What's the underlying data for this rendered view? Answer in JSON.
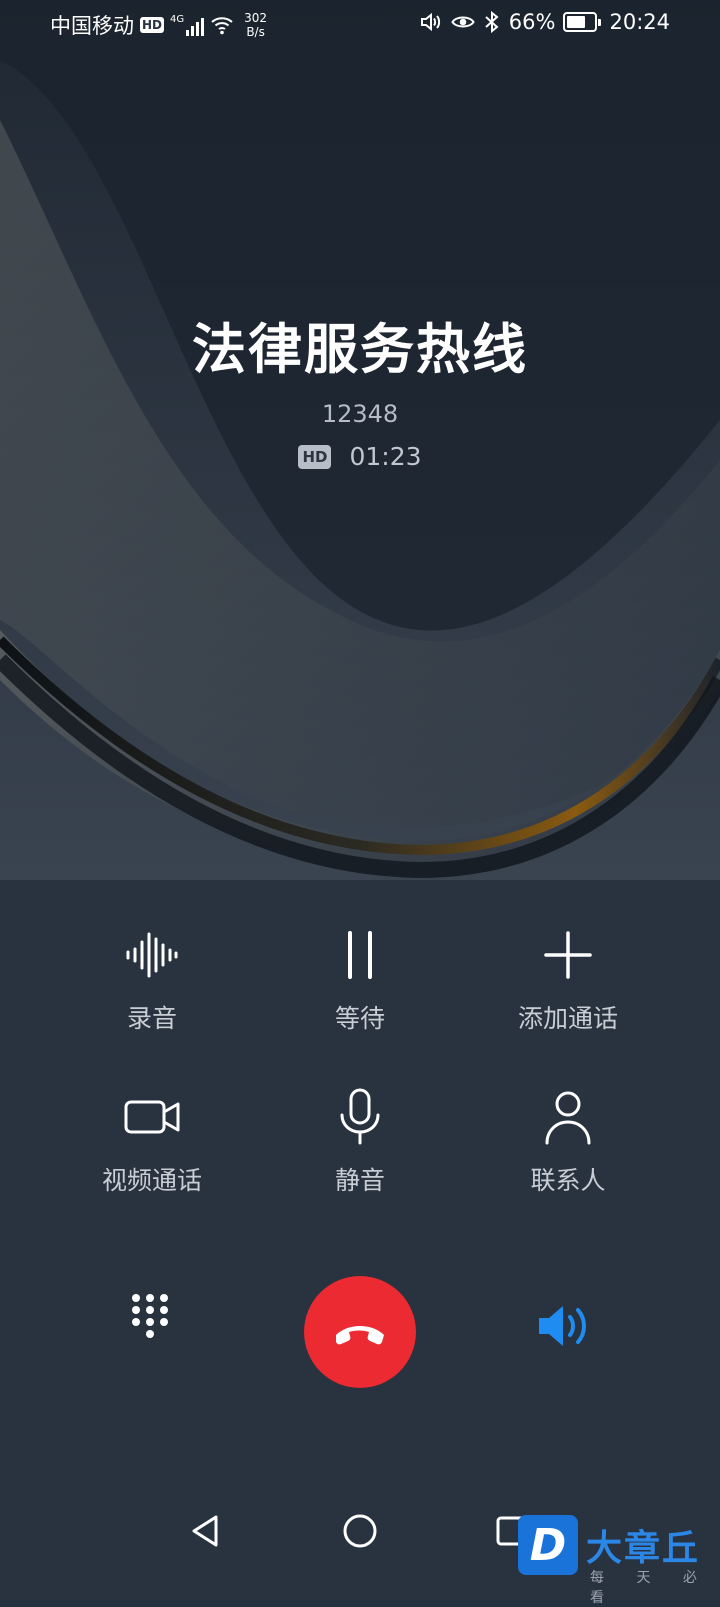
{
  "status_bar": {
    "carrier": "中国移动",
    "hd_label": "HD",
    "network": "4G",
    "speed_value": "302",
    "speed_unit": "B/s",
    "battery": "66%",
    "time": "20:24"
  },
  "call": {
    "name": "法律服务热线",
    "number": "12348",
    "hd_label": "HD",
    "duration": "01:23"
  },
  "controls": {
    "record": {
      "label": "录音",
      "icon": "waveform-icon"
    },
    "hold": {
      "label": "等待",
      "icon": "pause-icon"
    },
    "add_call": {
      "label": "添加通话",
      "icon": "plus-icon"
    },
    "video_call": {
      "label": "视频通话",
      "icon": "video-camera-icon"
    },
    "mute": {
      "label": "静音",
      "icon": "microphone-icon"
    },
    "contacts": {
      "label": "联系人",
      "icon": "person-icon"
    }
  },
  "bottom": {
    "dialpad_icon": "dialpad-icon",
    "hangup_icon": "hang-up-icon",
    "speaker_icon": "speaker-icon",
    "speaker_color": "#1e8cf0",
    "hangup_color": "#ec2a31"
  },
  "watermark": {
    "logo_letter": "D",
    "brand": "大章丘",
    "slogan": "每 天 必 看"
  }
}
